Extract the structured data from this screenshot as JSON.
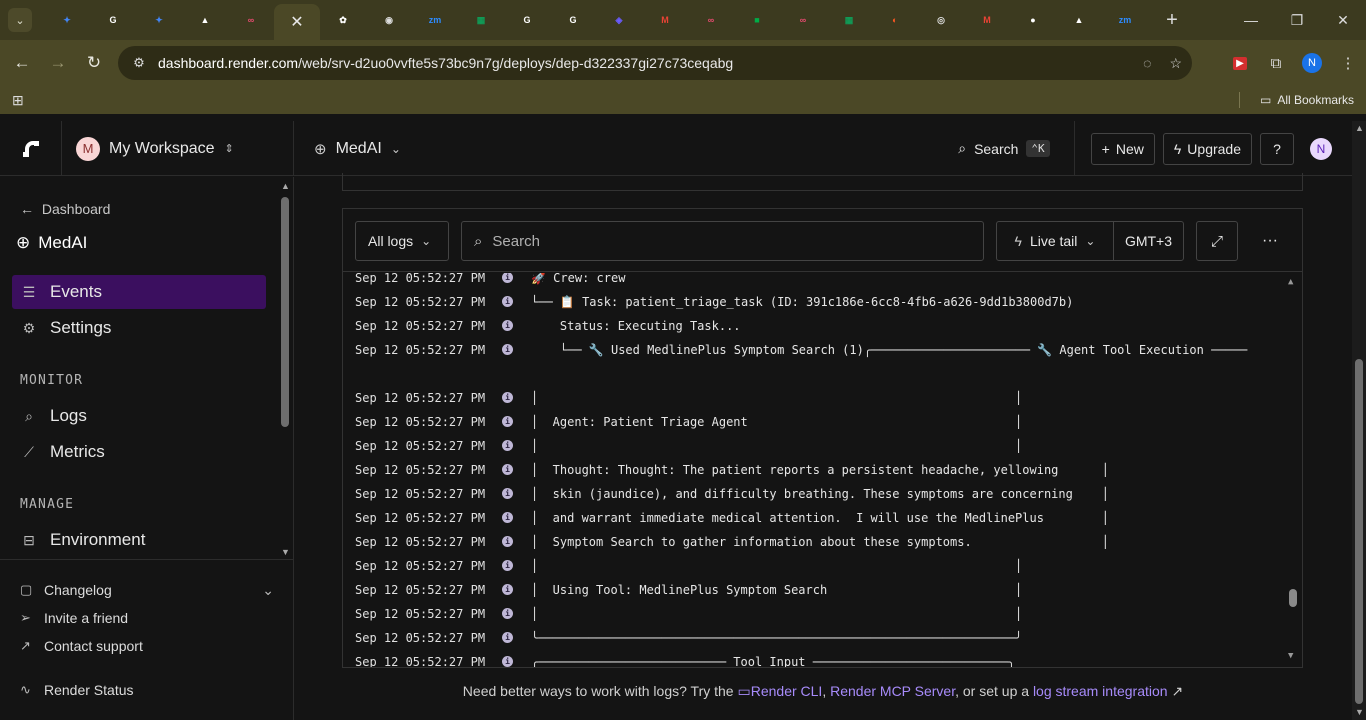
{
  "browser": {
    "tabs": [
      {
        "icon": "gemini-icon",
        "color": "#4285f4",
        "glyph": "✦"
      },
      {
        "icon": "google-icon",
        "color": "#ffffff",
        "glyph": "G"
      },
      {
        "icon": "gemini-icon",
        "color": "#4285f4",
        "glyph": "✦"
      },
      {
        "icon": "vercel-icon",
        "color": "#ffffff",
        "glyph": "▲"
      },
      {
        "icon": "n8n-icon",
        "color": "#ea4b71",
        "glyph": "∞"
      },
      {
        "icon": "close-icon",
        "color": "#ffffff",
        "glyph": "✕",
        "active": true
      },
      {
        "icon": "openai-icon",
        "color": "#ffffff",
        "glyph": "✿"
      },
      {
        "icon": "globe-icon",
        "color": "#dddddd",
        "glyph": "◉"
      },
      {
        "icon": "zoom-icon",
        "color": "#2d8cff",
        "glyph": "zm"
      },
      {
        "icon": "sheets-icon",
        "color": "#0f9d58",
        "glyph": "▦"
      },
      {
        "icon": "google-icon",
        "color": "#ffffff",
        "glyph": "G"
      },
      {
        "icon": "google-icon",
        "color": "#ffffff",
        "glyph": "G"
      },
      {
        "icon": "app-icon",
        "color": "#6a5cff",
        "glyph": "◈"
      },
      {
        "icon": "gmail-icon",
        "color": "#ea4335",
        "glyph": "M"
      },
      {
        "icon": "n8n-icon",
        "color": "#ea4b71",
        "glyph": "∞"
      },
      {
        "icon": "meet-icon",
        "color": "#00ac47",
        "glyph": "■"
      },
      {
        "icon": "n8n-icon",
        "color": "#ea4b71",
        "glyph": "∞"
      },
      {
        "icon": "sheets-icon",
        "color": "#0f9d58",
        "glyph": "▦"
      },
      {
        "icon": "app-icon",
        "color": "#ff5722",
        "glyph": "◐"
      },
      {
        "icon": "chrome-icon",
        "color": "#dddddd",
        "glyph": "◎"
      },
      {
        "icon": "gmail-icon",
        "color": "#ea4335",
        "glyph": "M"
      },
      {
        "icon": "github-icon",
        "color": "#ffffff",
        "glyph": "●"
      },
      {
        "icon": "vercel-icon",
        "color": "#ffffff",
        "glyph": "▲"
      },
      {
        "icon": "zoom-icon",
        "color": "#2d8cff",
        "glyph": "zm"
      }
    ],
    "url_host": "dashboard.render.com",
    "url_path": "/web/srv-d2uo0vvfte5s73bc9n7g/deploys/dep-d322337gi27c73ceqabg",
    "profile_initial": "N",
    "all_bookmarks": "All Bookmarks"
  },
  "app": {
    "workspace_initial": "M",
    "workspace_name": "My Workspace",
    "service_name": "MedAI",
    "search_label": "Search",
    "search_kbd": "⌃K",
    "new_label": "New",
    "upgrade_label": "Upgrade",
    "user_initial": "N"
  },
  "sidebar": {
    "back_label": "Dashboard",
    "service_name": "MedAI",
    "items": [
      {
        "label": "Events",
        "icon": "list-icon",
        "active": true
      },
      {
        "label": "Settings",
        "icon": "gear-icon"
      }
    ],
    "monitor_heading": "MONITOR",
    "monitor_items": [
      {
        "label": "Logs",
        "icon": "logs-icon"
      },
      {
        "label": "Metrics",
        "icon": "metrics-icon"
      }
    ],
    "manage_heading": "MANAGE",
    "manage_items": [
      {
        "label": "Environment",
        "icon": "environment-icon"
      }
    ],
    "bottom": {
      "changelog": "Changelog",
      "invite": "Invite a friend",
      "support": "Contact support",
      "status": "Render Status"
    }
  },
  "logs": {
    "filter_label": "All logs",
    "search_placeholder": "Search",
    "live_tail": "Live tail",
    "timezone": "GMT+3",
    "lines": [
      {
        "ts": "Sep 12 05:52:27 PM",
        "msg": "🚀 Crew: crew"
      },
      {
        "ts": "Sep 12 05:52:27 PM",
        "msg": "└── 📋 Task: patient_triage_task (ID: 391c186e-6cc8-4fb6-a626-9dd1b3800d7b)"
      },
      {
        "ts": "Sep 12 05:52:27 PM",
        "msg": "    Status: Executing Task..."
      },
      {
        "ts": "Sep 12 05:52:27 PM",
        "msg": "    └── 🔧 Used MedlinePlus Symptom Search (1)╭────────────────────── 🔧 Agent Tool Execution ─────"
      },
      {
        "ts": "",
        "msg": ""
      },
      {
        "ts": "Sep 12 05:52:27 PM",
        "msg": "│                                                                  │"
      },
      {
        "ts": "Sep 12 05:52:27 PM",
        "msg": "│  Agent: Patient Triage Agent                                     │"
      },
      {
        "ts": "Sep 12 05:52:27 PM",
        "msg": "│                                                                  │"
      },
      {
        "ts": "Sep 12 05:52:27 PM",
        "msg": "│  Thought: Thought: The patient reports a persistent headache, yellowing      │"
      },
      {
        "ts": "Sep 12 05:52:27 PM",
        "msg": "│  skin (jaundice), and difficulty breathing. These symptoms are concerning    │"
      },
      {
        "ts": "Sep 12 05:52:27 PM",
        "msg": "│  and warrant immediate medical attention.  I will use the MedlinePlus        │"
      },
      {
        "ts": "Sep 12 05:52:27 PM",
        "msg": "│  Symptom Search to gather information about these symptoms.                  │"
      },
      {
        "ts": "Sep 12 05:52:27 PM",
        "msg": "│                                                                  │"
      },
      {
        "ts": "Sep 12 05:52:27 PM",
        "msg": "│  Using Tool: MedlinePlus Symptom Search                          │"
      },
      {
        "ts": "Sep 12 05:52:27 PM",
        "msg": "│                                                                  │"
      },
      {
        "ts": "Sep 12 05:52:27 PM",
        "msg": "╰──────────────────────────────────────────────────────────────────╯"
      },
      {
        "ts": "Sep 12 05:52:27 PM",
        "msg": "╭────────────────────────── Tool Input ───────────────────────────╮"
      }
    ]
  },
  "footer": {
    "prefix": "Need better ways to work with logs? Try the",
    "cli": "Render CLI",
    "comma": ",",
    "mcp": "Render MCP Server",
    "middle": ", or set up a",
    "integration": "log stream integration"
  }
}
